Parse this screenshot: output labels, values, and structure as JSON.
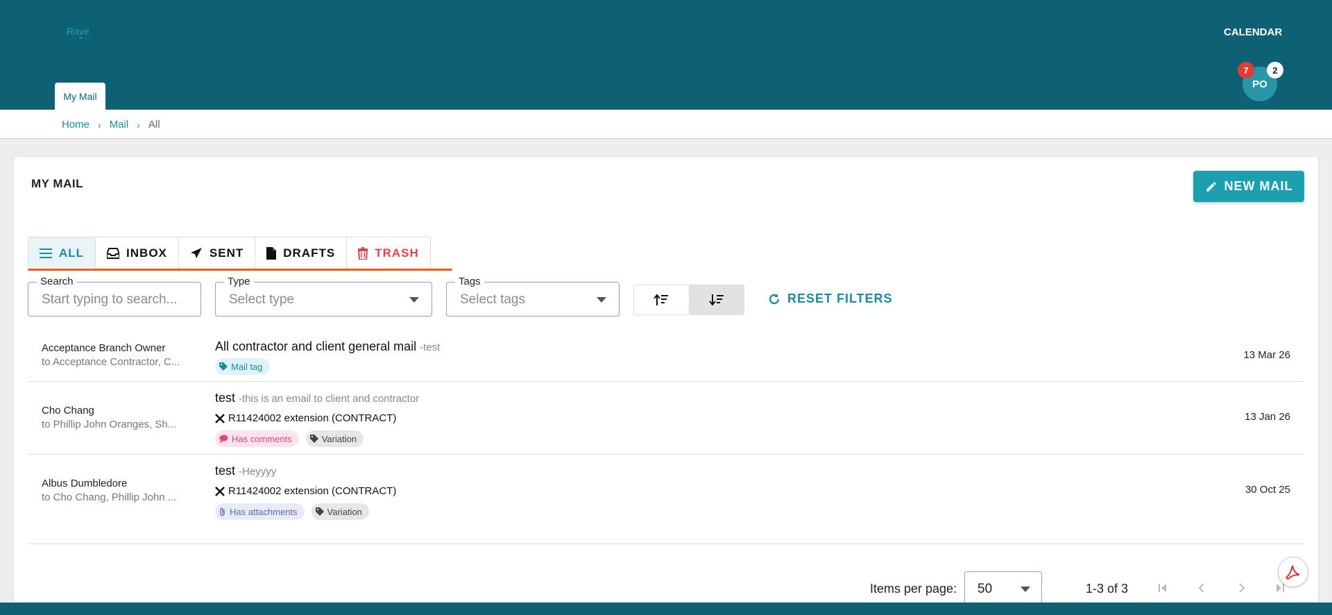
{
  "header": {
    "logo_text": "Rave",
    "calendar_label": "CALENDAR",
    "tab_label": "My Mail",
    "avatar_initials": "PO",
    "badge_red": "7",
    "badge_white": "2",
    "bg_color": "#0f5f75"
  },
  "breadcrumb": {
    "home": "Home",
    "mail": "Mail",
    "current": "All"
  },
  "page": {
    "title": "MY MAIL",
    "new_mail_label": "NEW MAIL"
  },
  "tabs": [
    {
      "label": "ALL",
      "icon": "menu-icon",
      "active": true
    },
    {
      "label": "INBOX",
      "icon": "inbox-icon"
    },
    {
      "label": "SENT",
      "icon": "send-icon"
    },
    {
      "label": "DRAFTS",
      "icon": "file-icon"
    },
    {
      "label": "TRASH",
      "icon": "trash-icon"
    }
  ],
  "filters": {
    "search_label": "Search",
    "search_placeholder": "Start typing to search...",
    "type_label": "Type",
    "type_placeholder": "Select type",
    "tags_label": "Tags",
    "tags_placeholder": "Select tags",
    "reset_label": "RESET FILTERS"
  },
  "mails": [
    {
      "from": "Acceptance Branch Owner",
      "to": "to Acceptance Contractor, C...",
      "subject": "All contractor and client general mail",
      "snippet": "-test",
      "tags": [
        {
          "label": "Mail tag",
          "style": "teal",
          "icon": "tag-icon"
        }
      ],
      "date": "13 Mar 26"
    },
    {
      "from": "Cho Chang",
      "to": "to Phillip John Oranges, Sh...",
      "subject": "test",
      "snippet": "-this is an email to client and contractor",
      "contract": "R11424002 extension (CONTRACT)",
      "tags": [
        {
          "label": "Has comments",
          "style": "pink",
          "icon": "comment-icon"
        },
        {
          "label": "Variation",
          "style": "grey",
          "icon": "tag-icon"
        }
      ],
      "date": "13 Jan 26"
    },
    {
      "from": "Albus Dumbledore",
      "to": "to Cho Chang, Phillip John ...",
      "subject": "test",
      "snippet": "-Heyyyy",
      "contract": "R11424002 extension (CONTRACT)",
      "tags": [
        {
          "label": "Has attachments",
          "style": "lav",
          "icon": "paperclip-icon"
        },
        {
          "label": "Variation",
          "style": "grey",
          "icon": "tag-icon"
        }
      ],
      "date": "30 Oct 25"
    }
  ],
  "pagination": {
    "items_per_page_label": "Items per page:",
    "items_per_page": "50",
    "range": "1-3 of 3"
  },
  "colors": {
    "accent": "#1ba0b0",
    "trash": "#e0424f",
    "underline": "#f05a1a"
  }
}
